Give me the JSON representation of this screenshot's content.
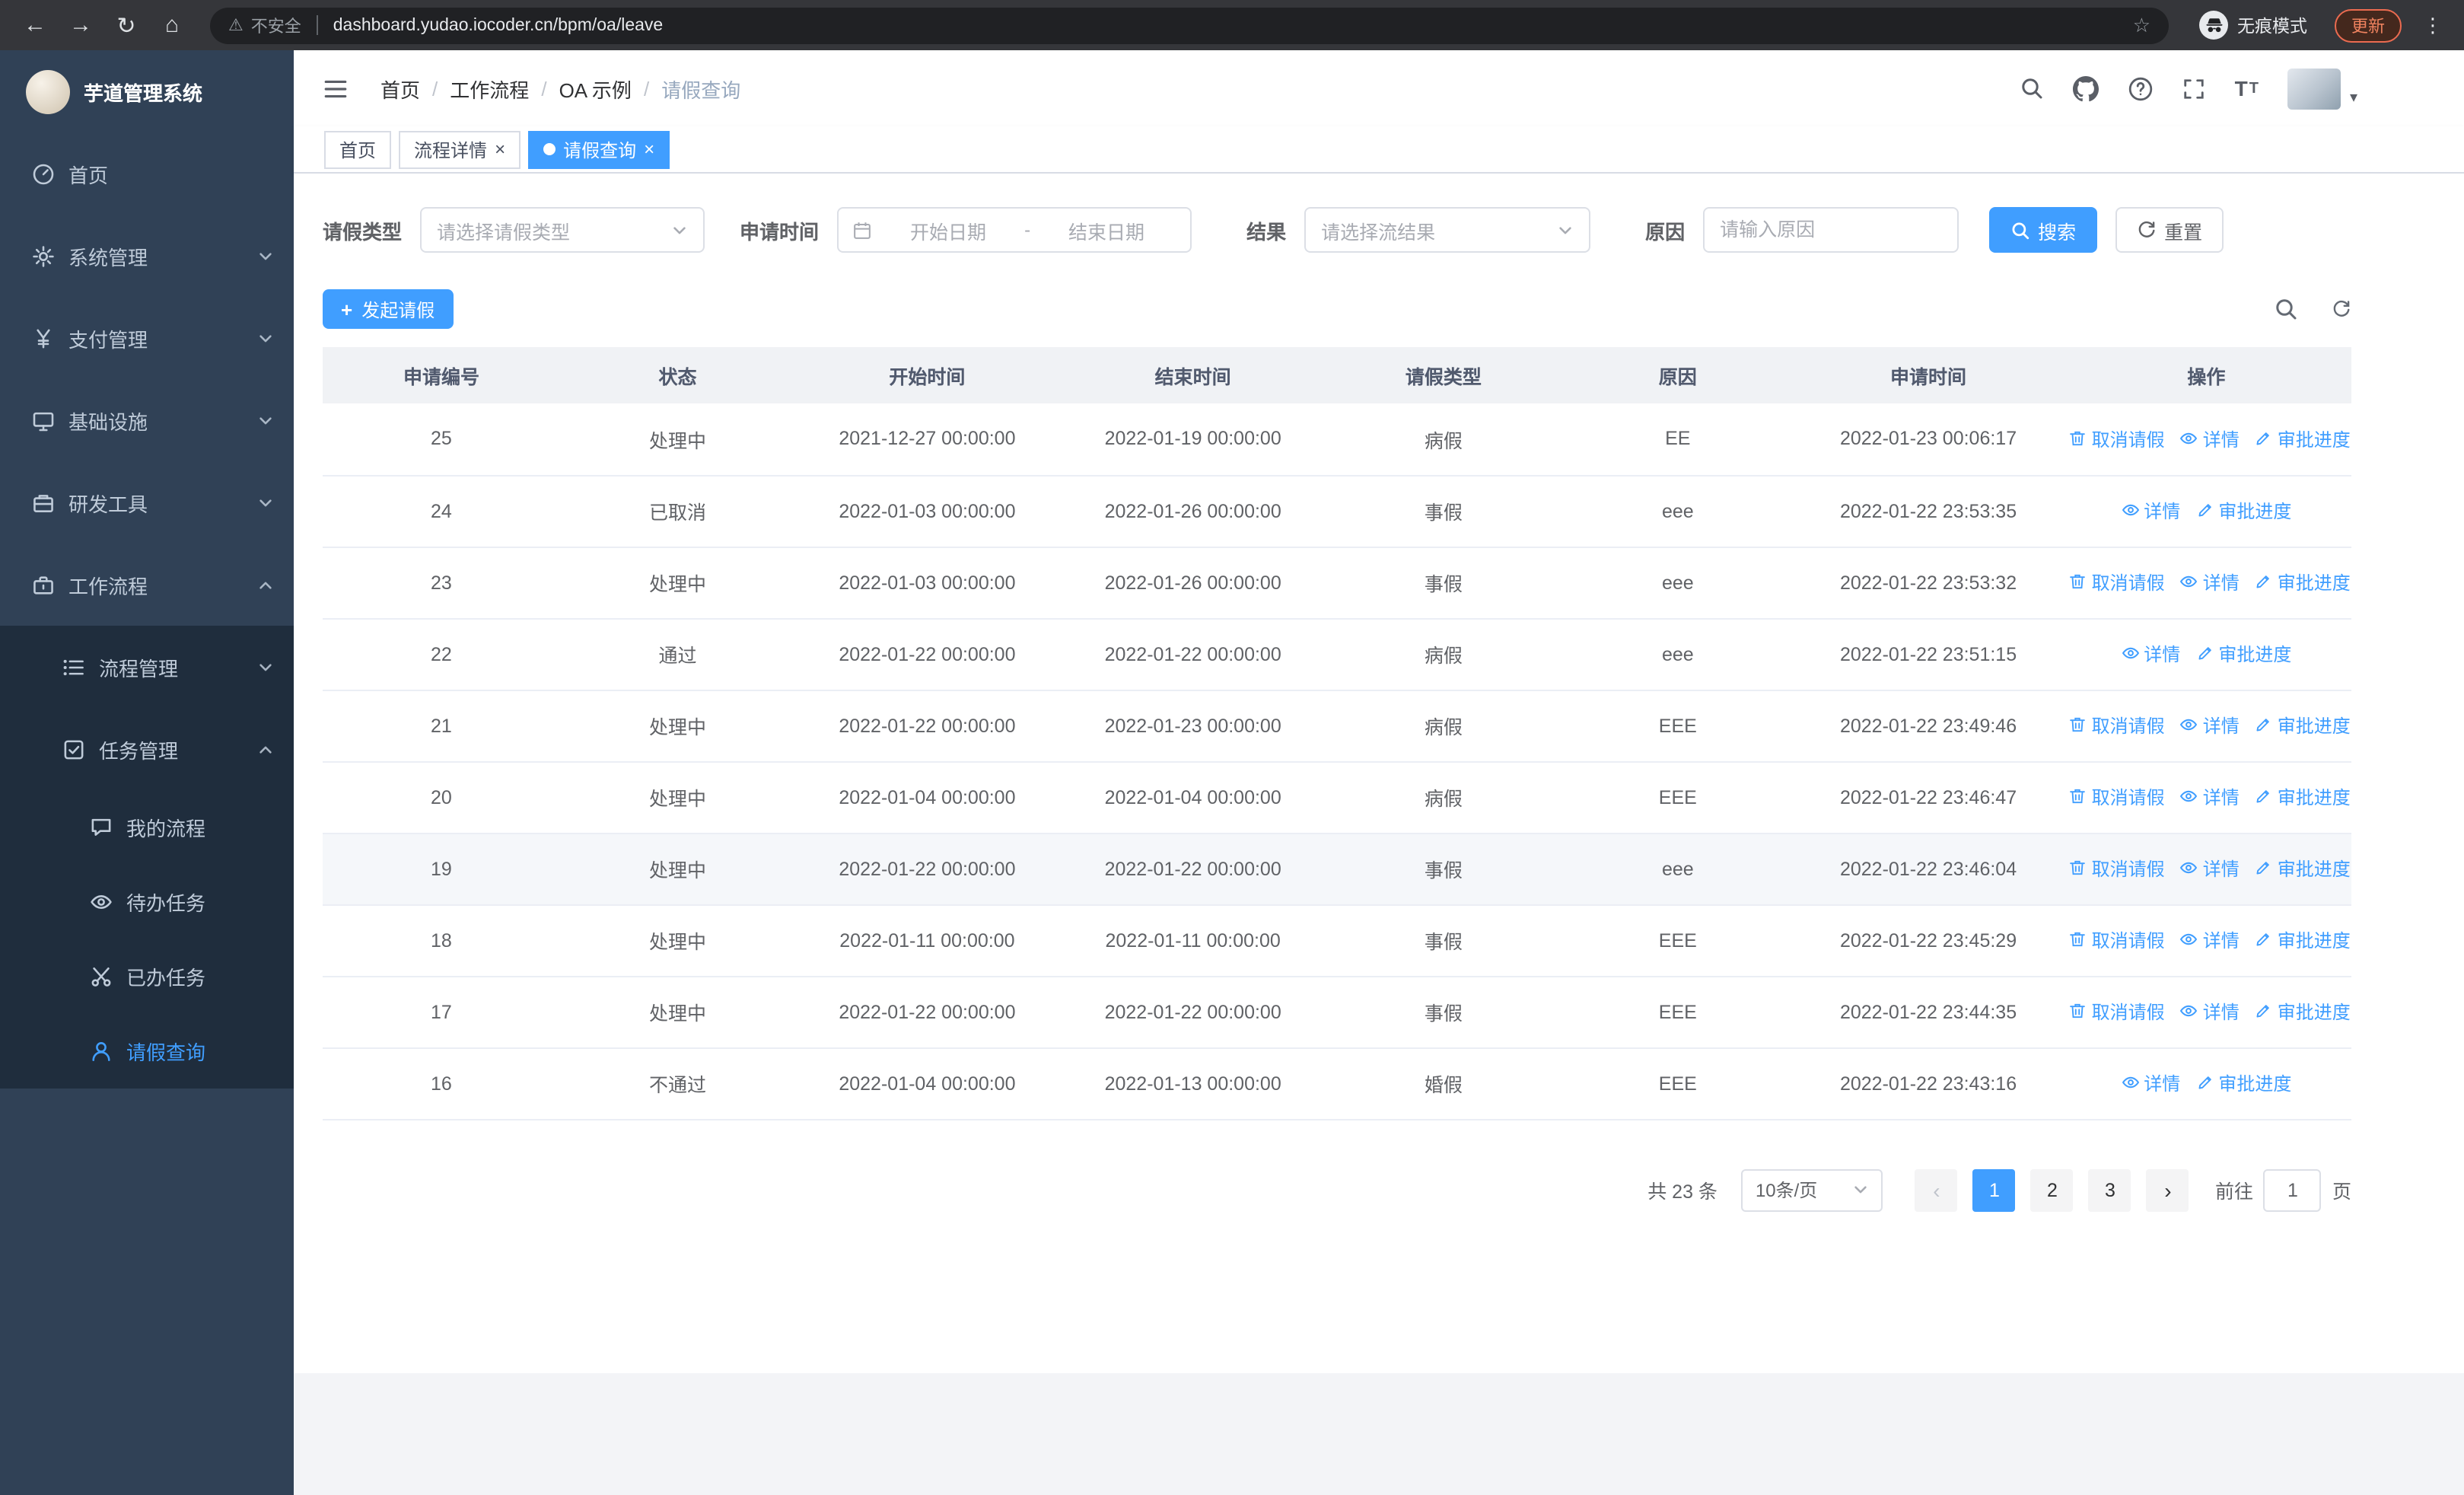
{
  "browser": {
    "security_label": "不安全",
    "url": "dashboard.yudao.iocoder.cn/bpm/oa/leave",
    "incognito_label": "无痕模式",
    "update_label": "更新"
  },
  "sidebar": {
    "app_title": "芋道管理系统",
    "items": [
      {
        "id": "home",
        "label": "首页",
        "icon": "dashboard",
        "level": 1
      },
      {
        "id": "system",
        "label": "系统管理",
        "icon": "gear",
        "level": 1,
        "chevron": "down"
      },
      {
        "id": "payment",
        "label": "支付管理",
        "icon": "yen",
        "level": 1,
        "chevron": "down"
      },
      {
        "id": "infra",
        "label": "基础设施",
        "icon": "monitor",
        "level": 1,
        "chevron": "down"
      },
      {
        "id": "devtools",
        "label": "研发工具",
        "icon": "toolbox",
        "level": 1,
        "chevron": "down"
      },
      {
        "id": "workflow",
        "label": "工作流程",
        "icon": "briefcase",
        "level": 1,
        "chevron": "up"
      },
      {
        "id": "process-mgmt",
        "label": "流程管理",
        "icon": "list",
        "level": 2,
        "chevron": "down"
      },
      {
        "id": "task-mgmt",
        "label": "任务管理",
        "icon": "task",
        "level": 2,
        "chevron": "up"
      },
      {
        "id": "my-process",
        "label": "我的流程",
        "icon": "chat",
        "level": 3
      },
      {
        "id": "todo-task",
        "label": "待办任务",
        "icon": "eye",
        "level": 3
      },
      {
        "id": "done-task",
        "label": "已办任务",
        "icon": "scissors",
        "level": 3
      },
      {
        "id": "leave-query",
        "label": "请假查询",
        "icon": "user",
        "level": 3,
        "active": true
      }
    ]
  },
  "header": {
    "breadcrumb": [
      "首页",
      "工作流程",
      "OA 示例",
      "请假查询"
    ],
    "icons": [
      "search",
      "github",
      "question",
      "fullscreen",
      "font-size"
    ]
  },
  "tabs": [
    {
      "id": "home",
      "label": "首页",
      "closable": false,
      "active": false
    },
    {
      "id": "process-detail",
      "label": "流程详情",
      "closable": true,
      "active": false
    },
    {
      "id": "leave-query",
      "label": "请假查询",
      "closable": true,
      "active": true
    }
  ],
  "filters": {
    "leave_type_label": "请假类型",
    "leave_type_placeholder": "请选择请假类型",
    "apply_time_label": "申请时间",
    "start_date_placeholder": "开始日期",
    "date_separator": "-",
    "end_date_placeholder": "结束日期",
    "result_label": "结果",
    "result_placeholder": "请选择流结果",
    "reason_label": "原因",
    "reason_placeholder": "请输入原因",
    "search_label": "搜索",
    "reset_label": "重置"
  },
  "toolbar": {
    "create_label": "发起请假"
  },
  "table": {
    "columns": [
      "申请编号",
      "状态",
      "开始时间",
      "结束时间",
      "请假类型",
      "原因",
      "申请时间",
      "操作"
    ],
    "action_labels": {
      "cancel": "取消请假",
      "detail": "详情",
      "progress": "审批进度"
    },
    "action_icons": {
      "cancel": "trash",
      "detail": "eye-sm",
      "progress": "pen"
    },
    "rows": [
      {
        "id": "25",
        "status": "处理中",
        "start": "2021-12-27 00:00:00",
        "end": "2022-01-19 00:00:00",
        "type": "病假",
        "reason": "EE",
        "apply_time": "2022-01-23 00:06:17",
        "actions": [
          "cancel",
          "detail",
          "progress"
        ]
      },
      {
        "id": "24",
        "status": "已取消",
        "start": "2022-01-03 00:00:00",
        "end": "2022-01-26 00:00:00",
        "type": "事假",
        "reason": "eee",
        "apply_time": "2022-01-22 23:53:35",
        "actions": [
          "detail",
          "progress"
        ]
      },
      {
        "id": "23",
        "status": "处理中",
        "start": "2022-01-03 00:00:00",
        "end": "2022-01-26 00:00:00",
        "type": "事假",
        "reason": "eee",
        "apply_time": "2022-01-22 23:53:32",
        "actions": [
          "cancel",
          "detail",
          "progress"
        ]
      },
      {
        "id": "22",
        "status": "通过",
        "start": "2022-01-22 00:00:00",
        "end": "2022-01-22 00:00:00",
        "type": "病假",
        "reason": "eee",
        "apply_time": "2022-01-22 23:51:15",
        "actions": [
          "detail",
          "progress"
        ]
      },
      {
        "id": "21",
        "status": "处理中",
        "start": "2022-01-22 00:00:00",
        "end": "2022-01-23 00:00:00",
        "type": "病假",
        "reason": "EEE",
        "apply_time": "2022-01-22 23:49:46",
        "actions": [
          "cancel",
          "detail",
          "progress"
        ]
      },
      {
        "id": "20",
        "status": "处理中",
        "start": "2022-01-04 00:00:00",
        "end": "2022-01-04 00:00:00",
        "type": "病假",
        "reason": "EEE",
        "apply_time": "2022-01-22 23:46:47",
        "actions": [
          "cancel",
          "detail",
          "progress"
        ]
      },
      {
        "id": "19",
        "status": "处理中",
        "start": "2022-01-22 00:00:00",
        "end": "2022-01-22 00:00:00",
        "type": "事假",
        "reason": "eee",
        "apply_time": "2022-01-22 23:46:04",
        "actions": [
          "cancel",
          "detail",
          "progress"
        ],
        "highlighted": true
      },
      {
        "id": "18",
        "status": "处理中",
        "start": "2022-01-11 00:00:00",
        "end": "2022-01-11 00:00:00",
        "type": "事假",
        "reason": "EEE",
        "apply_time": "2022-01-22 23:45:29",
        "actions": [
          "cancel",
          "detail",
          "progress"
        ]
      },
      {
        "id": "17",
        "status": "处理中",
        "start": "2022-01-22 00:00:00",
        "end": "2022-01-22 00:00:00",
        "type": "事假",
        "reason": "EEE",
        "apply_time": "2022-01-22 23:44:35",
        "actions": [
          "cancel",
          "detail",
          "progress"
        ]
      },
      {
        "id": "16",
        "status": "不通过",
        "start": "2022-01-04 00:00:00",
        "end": "2022-01-13 00:00:00",
        "type": "婚假",
        "reason": "EEE",
        "apply_time": "2022-01-22 23:43:16",
        "actions": [
          "detail",
          "progress"
        ]
      }
    ]
  },
  "pagination": {
    "total_label": "共 23 条",
    "page_size_label": "10条/页",
    "pages": [
      "1",
      "2",
      "3"
    ],
    "active_page": "1",
    "prev_disabled": true,
    "goto_label": "前往",
    "goto_value": "1",
    "goto_suffix": "页"
  },
  "colors": {
    "primary": "#409eff",
    "sidebar_bg": "#304156",
    "submenu_bg": "#1f2d3d",
    "table_header_bg": "#f0f2f5"
  }
}
